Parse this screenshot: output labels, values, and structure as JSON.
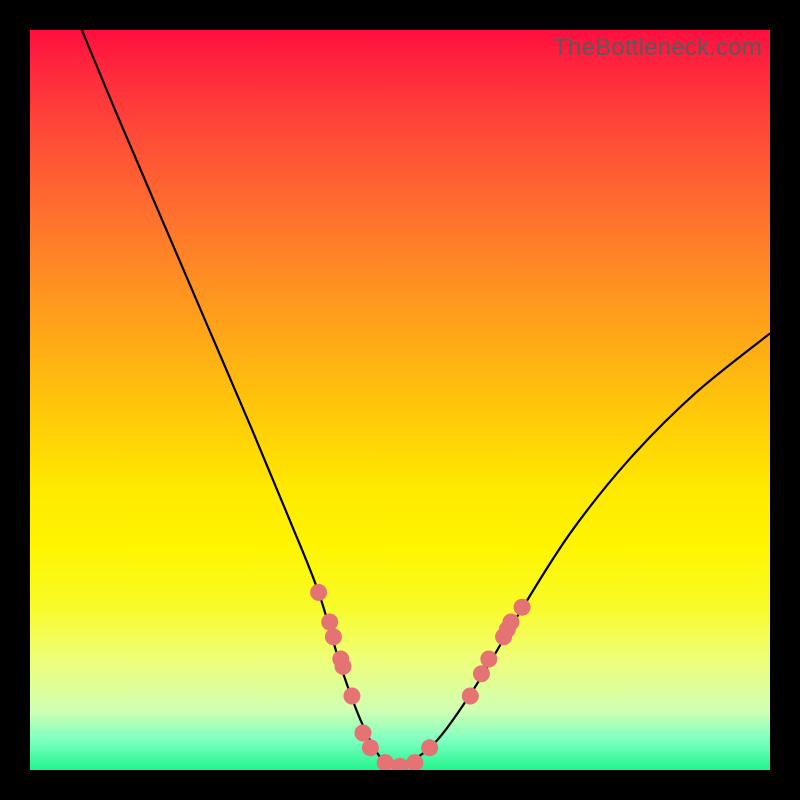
{
  "watermark": "TheBottleneck.com",
  "chart_data": {
    "type": "line",
    "title": "",
    "xlabel": "",
    "ylabel": "",
    "xlim": [
      0,
      100
    ],
    "ylim": [
      0,
      100
    ],
    "series": [
      {
        "name": "bottleneck-curve",
        "x": [
          7,
          12,
          18,
          24,
          30,
          35,
          39,
          42,
          45,
          48,
          51,
          55,
          60,
          66,
          73,
          81,
          90,
          100
        ],
        "y": [
          100,
          88,
          74,
          60,
          46,
          34,
          24,
          14,
          6,
          1,
          1,
          4,
          11,
          21,
          32,
          42,
          51,
          59
        ]
      }
    ],
    "markers": {
      "name": "highlighted-points",
      "color": "#e57373",
      "points": [
        {
          "x": 39.0,
          "y": 24
        },
        {
          "x": 40.5,
          "y": 20
        },
        {
          "x": 41.0,
          "y": 18
        },
        {
          "x": 42.0,
          "y": 15
        },
        {
          "x": 42.3,
          "y": 14
        },
        {
          "x": 43.5,
          "y": 10
        },
        {
          "x": 45.0,
          "y": 5
        },
        {
          "x": 46.0,
          "y": 3
        },
        {
          "x": 48.0,
          "y": 1
        },
        {
          "x": 50.0,
          "y": 0.5
        },
        {
          "x": 52.0,
          "y": 1
        },
        {
          "x": 54.0,
          "y": 3
        },
        {
          "x": 59.5,
          "y": 10
        },
        {
          "x": 61.0,
          "y": 13
        },
        {
          "x": 62.0,
          "y": 15
        },
        {
          "x": 64.0,
          "y": 18
        },
        {
          "x": 64.5,
          "y": 19
        },
        {
          "x": 65.0,
          "y": 20
        },
        {
          "x": 66.5,
          "y": 22
        }
      ]
    },
    "background_gradient": {
      "top": "#ff0e3f",
      "mid": "#ffe900",
      "bottom": "#22f58e"
    }
  }
}
